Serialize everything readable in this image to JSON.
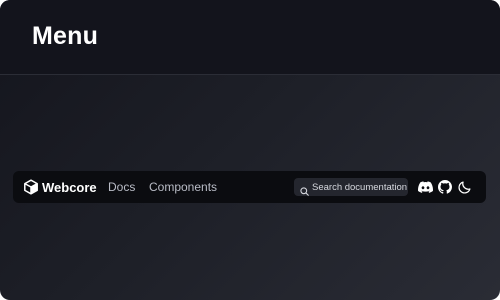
{
  "header": {
    "title": "Menu"
  },
  "navbar": {
    "brand": {
      "name": "Webcore",
      "icon": "cube-logo-icon"
    },
    "links": [
      {
        "label": "Docs"
      },
      {
        "label": "Components"
      }
    ],
    "search": {
      "placeholder": "Search documentation",
      "icon": "search-icon"
    },
    "actions": [
      {
        "icon": "discord-icon"
      },
      {
        "icon": "github-icon"
      },
      {
        "icon": "moon-icon"
      }
    ]
  },
  "colors": {
    "header_bg": "#13141c",
    "navbar_bg": "#0b0c10",
    "search_bg": "#24262e",
    "text_primary": "#ffffff",
    "text_muted": "#b9bcc6"
  }
}
